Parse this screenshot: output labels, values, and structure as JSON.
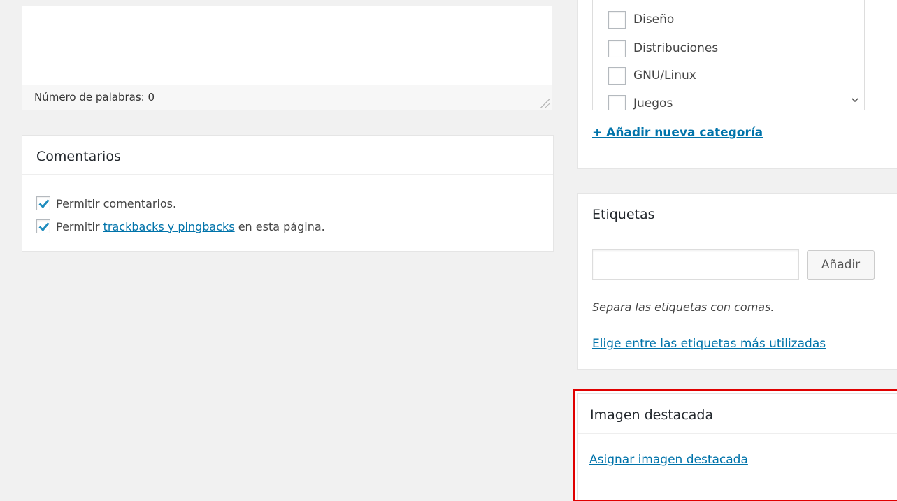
{
  "editor": {
    "word_count": "Número de palabras: 0"
  },
  "comments": {
    "title": "Comentarios",
    "allow_comments": {
      "label": "Permitir comentarios.",
      "checked": true
    },
    "allow_pings": {
      "prefix": "Permitir ",
      "link": "trackbacks y pingbacks",
      "suffix": " en esta página.",
      "checked": true
    }
  },
  "categories": {
    "items": [
      {
        "label": "Diseño",
        "checked": false
      },
      {
        "label": "Distribuciones",
        "checked": false
      },
      {
        "label": "GNU/Linux",
        "checked": false
      },
      {
        "label": "Juegos",
        "checked": false
      }
    ],
    "add_link": "+ Añadir nueva categoría"
  },
  "tags": {
    "title": "Etiquetas",
    "input_value": "",
    "add_button": "Añadir",
    "hint": "Separa las etiquetas con comas.",
    "most_used_link": "Elige entre las etiquetas más utilizadas"
  },
  "featured_image": {
    "title": "Imagen destacada",
    "set_link": "Asignar imagen destacada",
    "highlight_color": "#e00000"
  },
  "colors": {
    "link": "#0073aa",
    "checkmark": "#1e8cbe",
    "background": "#f1f1f1"
  }
}
